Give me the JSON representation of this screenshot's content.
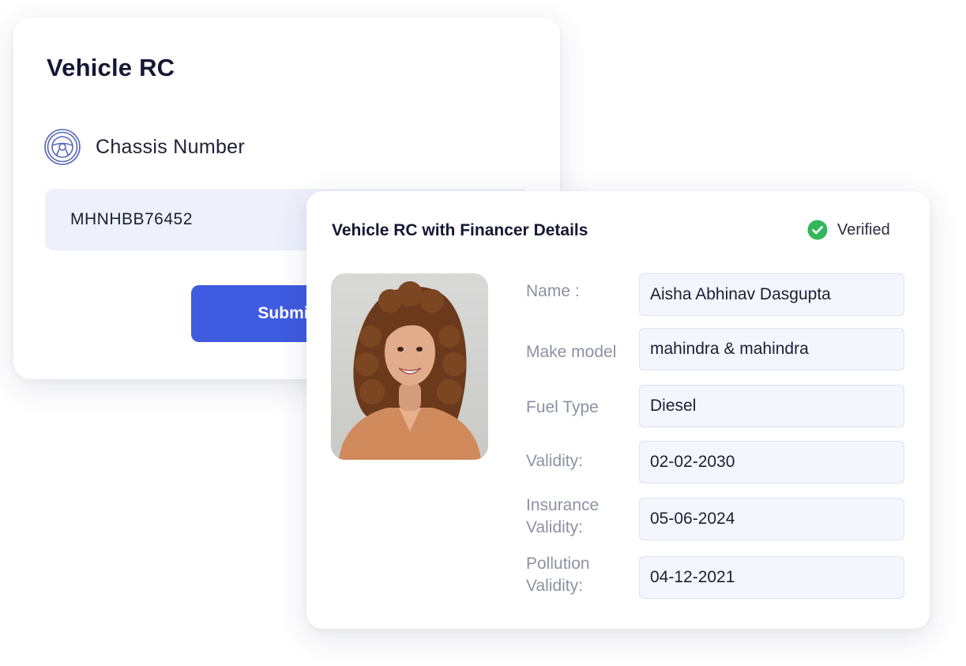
{
  "lookup_card": {
    "title": "Vehicle RC",
    "field_icon": "steering-wheel-icon",
    "field_label": "Chassis Number",
    "chassis_value": "MHNHBB76452",
    "submit_label": "Submit"
  },
  "result_card": {
    "title": "Vehicle RC with Financer Details",
    "status_icon": "check-circle-icon",
    "status_label": "Verified",
    "status_color": "#34b65a",
    "details": [
      {
        "label": "Name :",
        "value": "Aisha Abhinav Dasgupta"
      },
      {
        "label": "Make model",
        "value": "mahindra & mahindra"
      },
      {
        "label": "Fuel Type",
        "value": "Diesel"
      },
      {
        "label": "Validity:",
        "value": "02-02-2030"
      },
      {
        "label": "Insurance Validity:",
        "value": "05-06-2024"
      },
      {
        "label": "Pollution Validity:",
        "value": "04-12-2021"
      }
    ]
  },
  "colors": {
    "accent": "#3f5be0",
    "input_bg": "#eef1fb",
    "title_text": "#141833",
    "label_text": "#8c92a3"
  }
}
